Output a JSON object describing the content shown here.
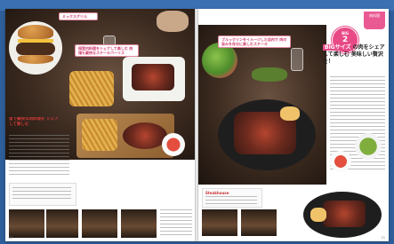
{
  "spread": {
    "left": {
      "photo_caption_1": "個室内料理をシェアして楽しむ 肉塊も豪快なステーキバーリス",
      "headline": "皆で豪快な肉料理を シェアして楽しむ",
      "folio": "20"
    },
    "right": {
      "corner_tag": "肉料理",
      "badge_label": "BIG",
      "badge_num": "2",
      "title_hl": "BIGサイズ",
      "title_rest": "の肉をシェアして楽しむ 美味しい贅沢を！",
      "photo_caption_2": "ブルックリンをイメージした店内で 肉の旨みを存分に楽しむステーキ",
      "shop_name": "Steakhouse",
      "folio": "21"
    }
  }
}
